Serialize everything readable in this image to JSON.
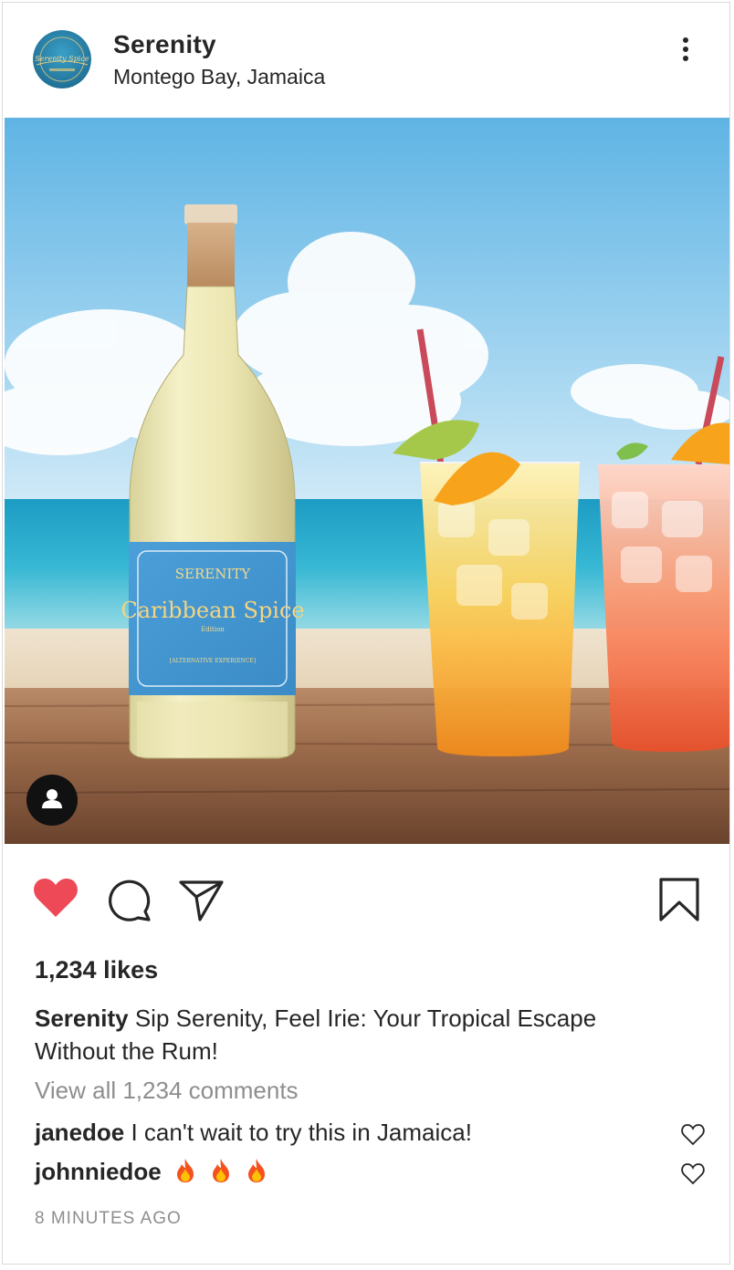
{
  "header": {
    "username": "Serenity",
    "location": "Montego Bay, Jamaica",
    "avatar_text": "Serenity Spice"
  },
  "photo": {
    "label_brand": "SERENITY",
    "label_name": "Caribbean Spice",
    "label_sub": "Edition",
    "label_tagline": "[ALTERNATIVE EXPERIENCE]"
  },
  "actions": {
    "liked": true,
    "like_color": "#ed4956",
    "icons": [
      "heart-icon",
      "comment-icon",
      "share-icon",
      "bookmark-icon"
    ]
  },
  "likes": {
    "text": "1,234 likes"
  },
  "caption": {
    "username": "Serenity",
    "text": "Sip Serenity, Feel Irie: Your Tropical Escape Without the Rum!"
  },
  "view_comments": "View all 1,234 comments",
  "comments": [
    {
      "username": "janedoe",
      "text": "I can't wait to try this in Jamaica!"
    },
    {
      "username": "johnniedoe",
      "text": "",
      "emoji": [
        "fire",
        "fire",
        "fire"
      ]
    }
  ],
  "timestamp": "8 MINUTES AGO"
}
